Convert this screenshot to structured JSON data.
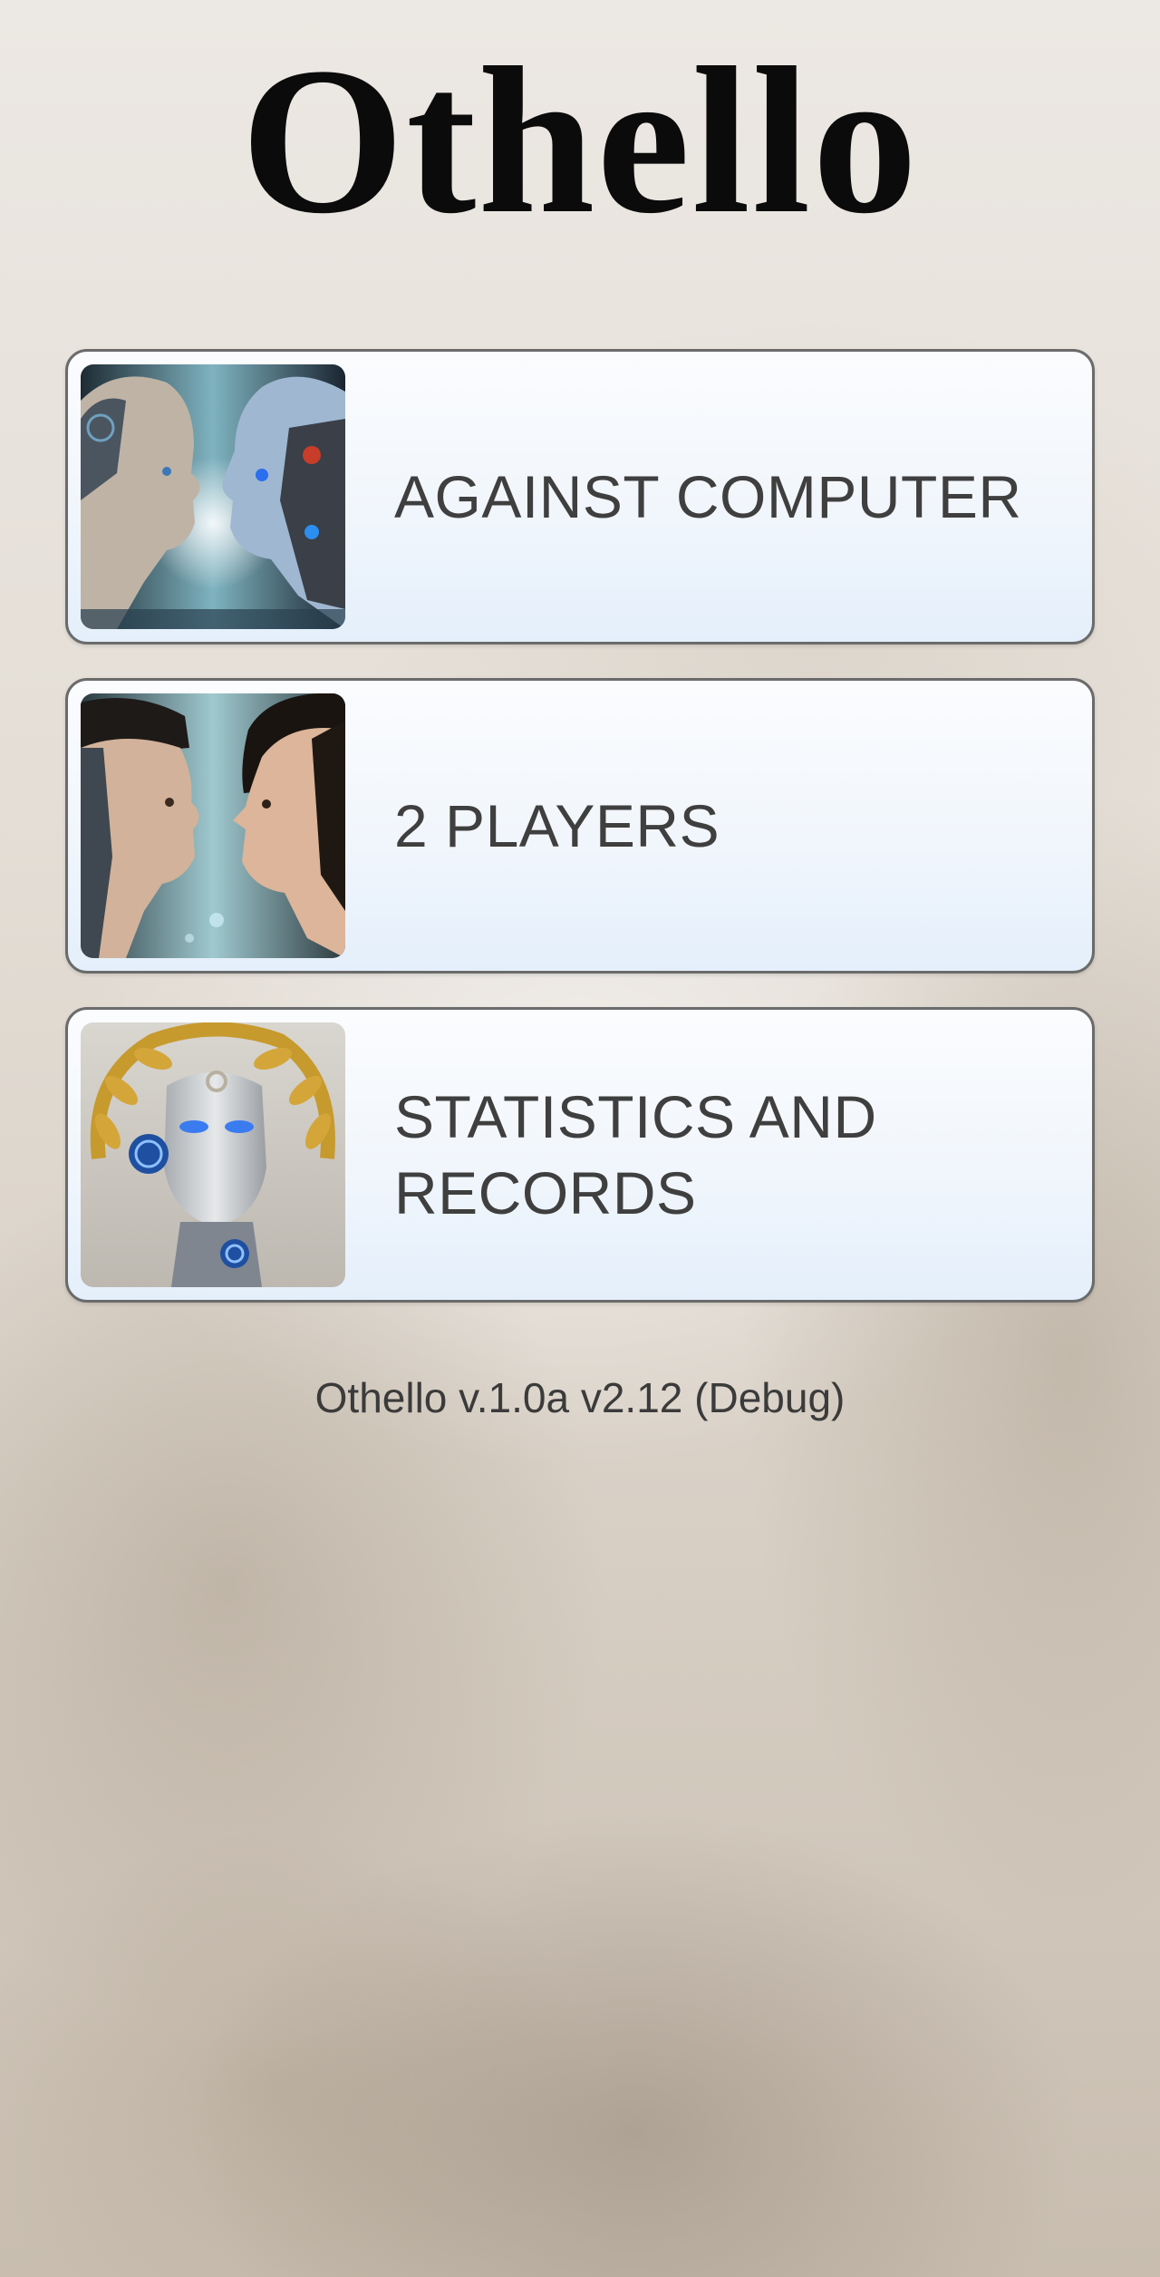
{
  "app": {
    "title": "Othello"
  },
  "menu": {
    "items": [
      {
        "label": "AGAINST COMPUTER",
        "icon": "human-vs-robot-icon"
      },
      {
        "label": "2 PLAYERS",
        "icon": "two-faces-icon"
      },
      {
        "label": "STATISTICS AND RECORDS",
        "icon": "laurel-android-icon"
      }
    ]
  },
  "footer": {
    "version": "Othello v.1.0a v2.12 (Debug)"
  },
  "colors": {
    "card_border": "#6b6b6b",
    "card_bg_top": "#fbfcfe",
    "card_bg_bottom": "#e4effb",
    "text": "#3f3f3f",
    "title": "#0b0b0b"
  }
}
